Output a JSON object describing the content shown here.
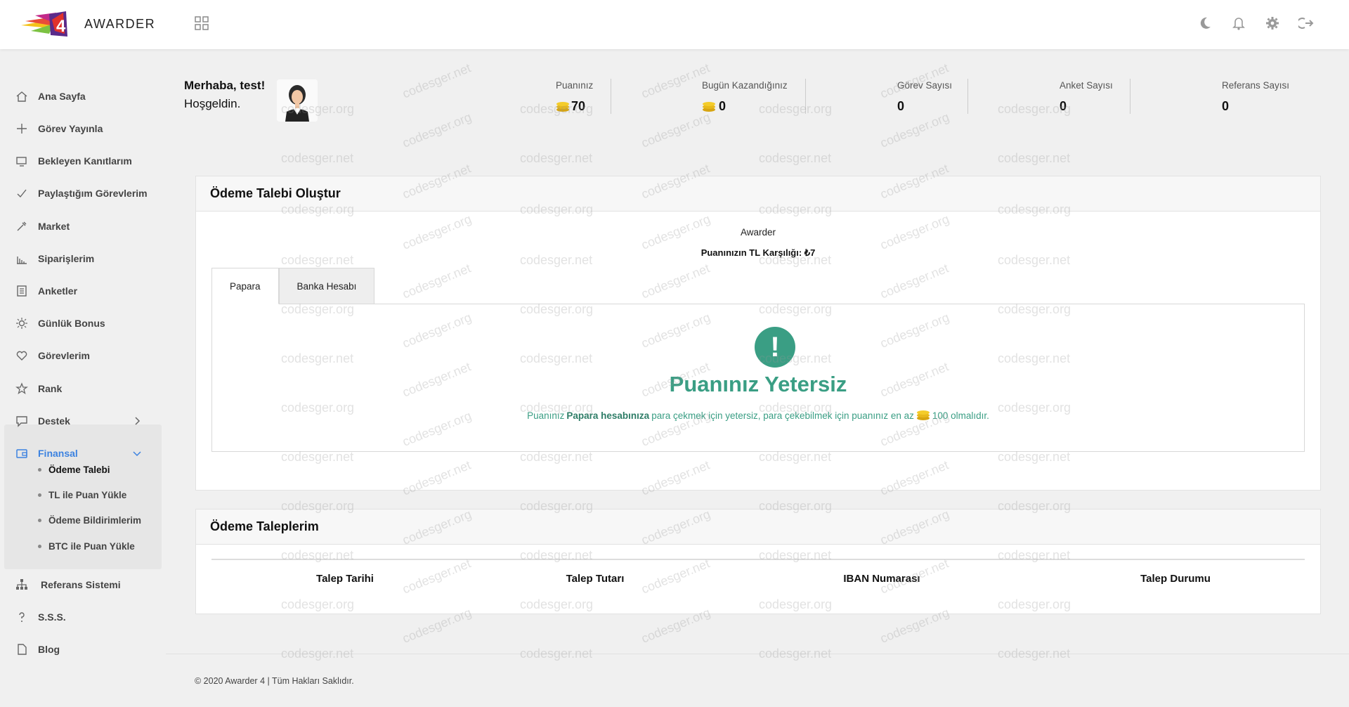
{
  "app": {
    "logo_text": "AWARDER"
  },
  "header": {
    "icons": [
      "grid-icon",
      "moon-icon",
      "bell-icon",
      "gear-icon",
      "logout-icon"
    ]
  },
  "sidebar": {
    "items": [
      {
        "label": "Ana Sayfa",
        "icon": "home-icon"
      },
      {
        "label": "Görev Yayınla",
        "icon": "plus-icon"
      },
      {
        "label": "Bekleyen Kanıtlarım",
        "icon": "screen-icon"
      },
      {
        "label": "Paylaştığım Görevlerim",
        "icon": "check-icon"
      },
      {
        "label": "Market",
        "icon": "tools-icon"
      },
      {
        "label": "Siparişlerim",
        "icon": "bar-chart-icon"
      },
      {
        "label": "Anketler",
        "icon": "document-icon"
      },
      {
        "label": "Günlük Bonus",
        "icon": "sun-icon"
      },
      {
        "label": "Görevlerim",
        "icon": "heart-icon"
      },
      {
        "label": "Rank",
        "icon": "star-icon"
      },
      {
        "label": "Destek",
        "icon": "chat-icon"
      },
      {
        "label": "Finansal",
        "icon": "wallet-icon"
      },
      {
        "label": "Referans Sistemi",
        "icon": "network-icon"
      },
      {
        "label": "S.S.S.",
        "icon": "question-icon"
      },
      {
        "label": "Blog",
        "icon": "file-icon"
      }
    ],
    "finansal_sub": [
      {
        "label": "Ödeme Talebi"
      },
      {
        "label": "TL ile Puan Yükle"
      },
      {
        "label": "Ödeme Bildirimlerim"
      },
      {
        "label": "BTC ile Puan Yükle"
      }
    ]
  },
  "welcome": {
    "hello": "Merhaba, test!",
    "sub": "Hoşgeldin."
  },
  "stats": [
    {
      "label": "Puanınız",
      "value": "70"
    },
    {
      "label": "Bugün Kazandığınız",
      "value": "0"
    },
    {
      "label": "Görev Sayısı",
      "value": "0"
    },
    {
      "label": "Anket Sayısı",
      "value": "0"
    },
    {
      "label": "Referans Sayısı",
      "value": "0"
    }
  ],
  "payment_request": {
    "title": "Ödeme Talebi Oluştur",
    "brand": "Awarder",
    "tl_equivalent": "Puanınızın TL Karşılığı: ₺7",
    "tabs": [
      {
        "label": "Papara",
        "active": true
      },
      {
        "label": "Banka Hesabı",
        "active": false
      }
    ],
    "warning": {
      "title": "Puanınız Yetersiz",
      "msg_prefix": "Puanınız",
      "msg_bold": "Papara hesabınıza",
      "msg_mid": "para çekmek için yetersiz, para çekebilmek için puanınız en az",
      "msg_suffix": "100 olmalıdır."
    },
    "accent_color": "#3a9e84"
  },
  "my_requests": {
    "title": "Ödeme Taleplerim",
    "columns": [
      "Talep Tarihi",
      "Talep Tutarı",
      "IBAN Numarası",
      "Talep Durumu"
    ]
  },
  "watermark": {
    "a": "codesger.org",
    "b": "codesger.net"
  },
  "footer": {
    "text": "© 2020 Awarder 4 | Tüm Hakları Saklıdır."
  }
}
